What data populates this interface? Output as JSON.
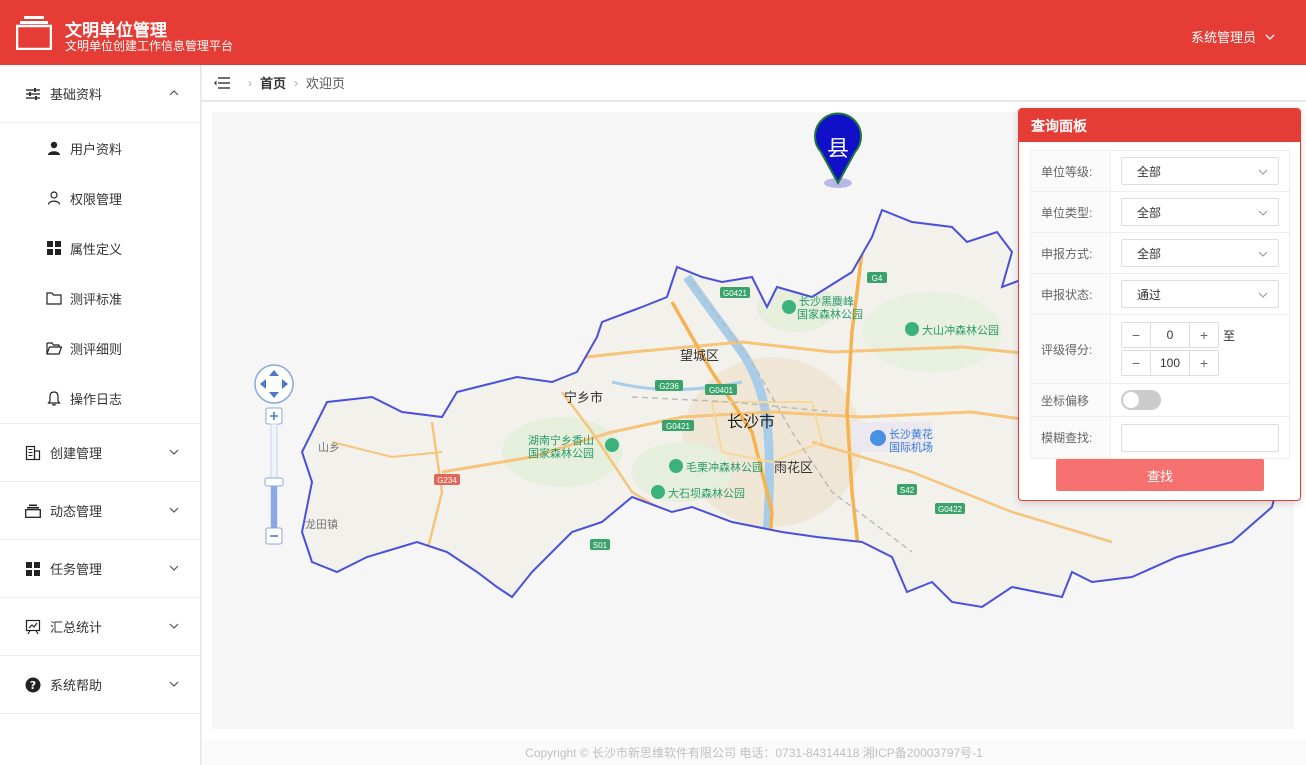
{
  "header": {
    "title": "文明单位管理",
    "subtitle": "文明单位创建工作信息管理平台",
    "user": "系统管理员",
    "color": "#e53d35"
  },
  "sidebar": {
    "groups": [
      {
        "label": "基础资料",
        "icon": "sliders-icon",
        "expanded": true,
        "items": [
          {
            "label": "用户资料",
            "icon": "user-solid-icon"
          },
          {
            "label": "权限管理",
            "icon": "user-outline-icon"
          },
          {
            "label": "属性定义",
            "icon": "grid-icon"
          },
          {
            "label": "测评标准",
            "icon": "folder-icon"
          },
          {
            "label": "测评细则",
            "icon": "folder-open-icon"
          },
          {
            "label": "操作日志",
            "icon": "bell-icon"
          }
        ]
      },
      {
        "label": "创建管理",
        "icon": "building-icon",
        "expanded": false
      },
      {
        "label": "动态管理",
        "icon": "layers-icon",
        "expanded": false
      },
      {
        "label": "任务管理",
        "icon": "grid-icon",
        "expanded": false
      },
      {
        "label": "汇总统计",
        "icon": "chart-icon",
        "expanded": false
      },
      {
        "label": "系统帮助",
        "icon": "help-icon",
        "expanded": false
      }
    ]
  },
  "breadcrumb": {
    "home": "首页",
    "current": "欢迎页"
  },
  "map": {
    "marker_label": "县",
    "places": {
      "wangcheng": "望城区",
      "ningxiang": "宁乡市",
      "changsha": "长沙市",
      "yuhua": "雨花区",
      "airport_1": "长沙黄花",
      "airport_2": "国际机场",
      "park_heimi_1": "长沙黑麋峰",
      "park_heimi_2": "国家森林公园",
      "park_dashan": "大山冲森林公园",
      "park_xiangshan_1": "湖南宁乡香山",
      "park_xiangshan_2": "国家森林公园",
      "park_maoli": "毛栗冲森林公园",
      "park_dashi": "大石坝森林公园",
      "town_shan": "山乡",
      "town_longtian": "龙田镇"
    },
    "roads": [
      "G0421",
      "G4",
      "G236",
      "G0401",
      "G0421",
      "G234",
      "S42",
      "G0422",
      "S01"
    ]
  },
  "query_panel": {
    "title": "查询面板",
    "fields": {
      "level_label": "单位等级:",
      "level_value": "全部",
      "type_label": "单位类型:",
      "type_value": "全部",
      "report_method_label": "申报方式:",
      "report_method_value": "全部",
      "report_status_label": "申报状态:",
      "report_status_value": "通过",
      "score_label": "评级得分:",
      "score_min": "0",
      "score_max": "100",
      "score_to": "至",
      "offset_label": "坐标偏移",
      "offset_enabled": false,
      "fuzzy_label": "模糊查找:",
      "fuzzy_value": ""
    },
    "search_button": "查找"
  },
  "footer": {
    "text": "Copyright © 长沙市新思维软件有限公司 电话：0731-84314418 湘ICP备20003797号-1"
  }
}
